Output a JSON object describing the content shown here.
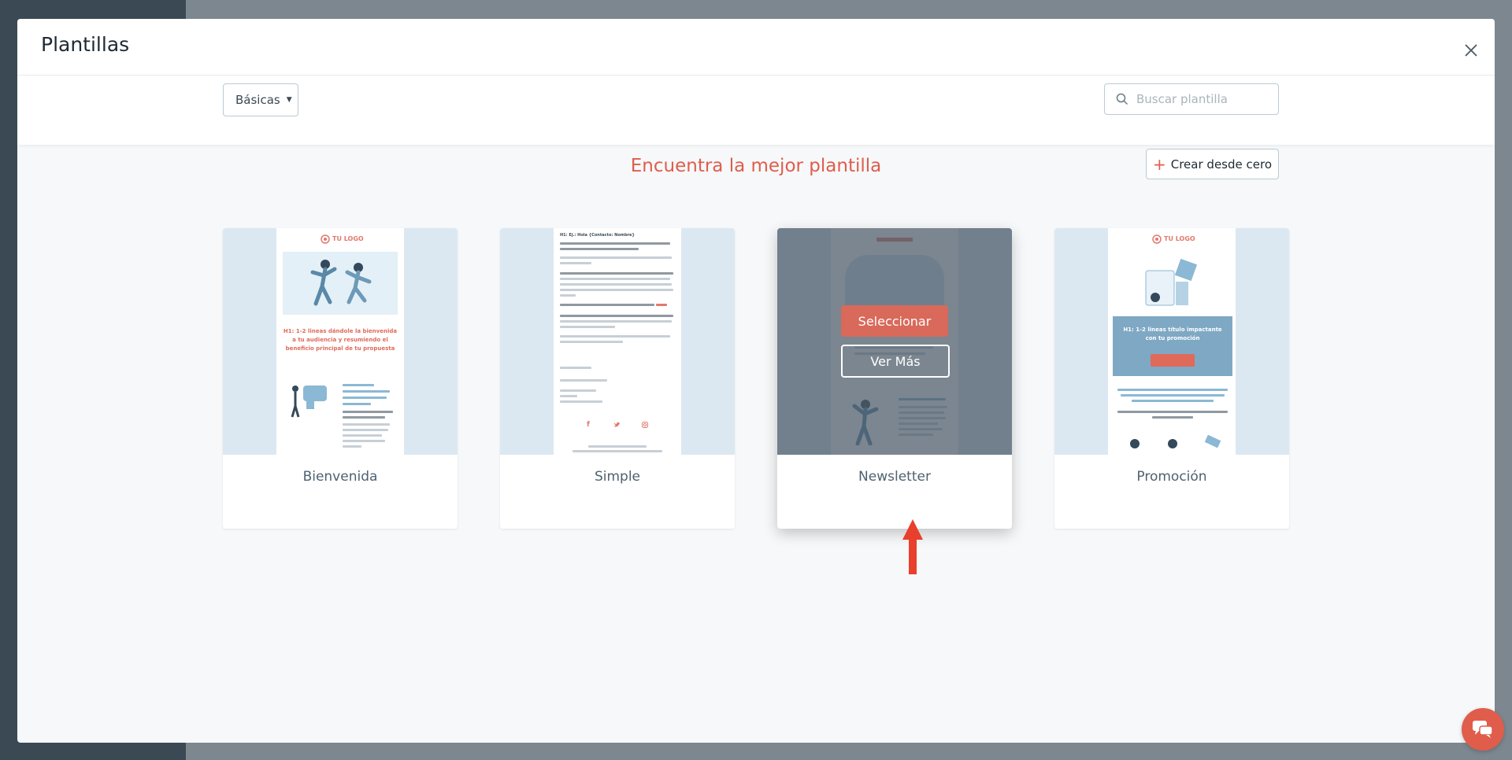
{
  "modal": {
    "title": "Plantillas"
  },
  "toolbar": {
    "category_label": "Básicas",
    "search_placeholder": "Buscar plantilla"
  },
  "main": {
    "headline": "Encuentra la mejor plantilla",
    "create_label": "Crear desde cero"
  },
  "templates": [
    {
      "name": "Bienvenida",
      "logo": "TU LOGO",
      "heading": "H1: 1-2 lineas dándole la bienvenida a tu audiencia y resumiendo el beneficio principal de tu propuesta"
    },
    {
      "name": "Simple",
      "heading": "H1: Ej.: Hola {Contacto: Nombre}"
    },
    {
      "name": "Newsletter"
    },
    {
      "name": "Promoción",
      "logo": "TU LOGO",
      "heading": "H1: 1-2 lineas título impactante con tu promoción"
    }
  ],
  "hover_actions": {
    "select_label": "Seleccionar",
    "more_label": "Ver Más"
  },
  "colors": {
    "accent": "#e05d4b",
    "select_button": "#d9695a",
    "thumb_bg": "#dce8f1"
  },
  "icons": {
    "close": "close-icon",
    "search": "search-icon",
    "caret": "caret-down-icon",
    "plus": "plus-icon",
    "chat": "chat-icon",
    "arrow": "arrow-up-icon"
  }
}
